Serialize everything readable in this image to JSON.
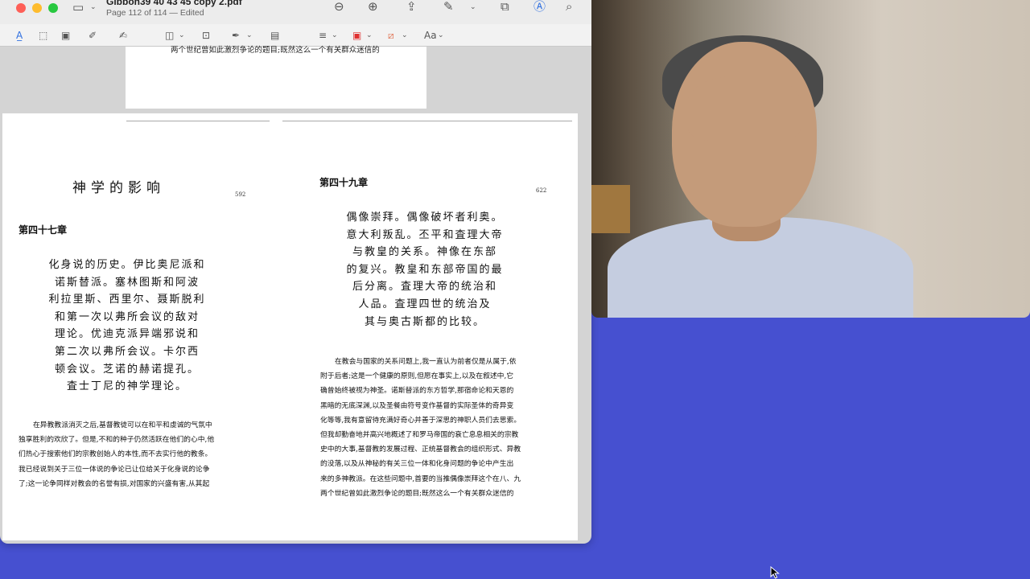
{
  "window": {
    "title": "Gibbon39 40 43 45 copy 2.pdf",
    "subtitle": "Page 112 of 114 — Edited"
  },
  "icons": [
    "sidebar-icon",
    "chevron-down-icon",
    "zoom-out-icon",
    "zoom-in-icon",
    "share-icon",
    "pencil-icon",
    "rotate-icon",
    "markup-icon",
    "search-icon",
    "text-selection-icon",
    "rect-selection-icon",
    "redact-icon",
    "sketch-icon",
    "draw-icon",
    "shapes-icon",
    "text-box-icon",
    "sign-icon",
    "note-icon",
    "line-style-icon",
    "border-color-icon",
    "fill-color-icon",
    "text-style-icon"
  ],
  "markup": {
    "text_style_label": "Aa"
  },
  "colors": {
    "desktop": "#4650d0",
    "border_color": "#e03030",
    "fill_color": "#e07050"
  },
  "prev_page": {
    "cut_line": "两个世纪曾如此激烈争论的题目;既然这么一个有关群众迷信的"
  },
  "left_page": {
    "heading": "神学的影响",
    "page_number": "592",
    "chapter": "第四十七章",
    "summary": [
      "化身说的历史。伊比奥尼派和",
      "诺斯替派。塞林图斯和阿波",
      "利拉里斯、西里尔、聂斯脱利",
      "和第一次以弗所会议的敌对",
      "理论。优迪克派异端邪说和",
      "第二次以弗所会议。卡尔西",
      "顿会议。芝诺的赫诺提孔。",
      "査士丁尼的神学理论。"
    ],
    "body": [
      "在异教教派消灭之后,基督教徒可以在和平和虔诚的气氛中",
      "独享胜利的欢欣了。但是,不和的种子仍然活跃在他们的心中,他",
      "们热心于搜索他们的宗教创始人的本性,而不去实行他的教条。",
      "我已经说到关于三位一体说的争论已让位给关于化身说的论争",
      "了;这一论争同样对教会的名誉有损,对国家的兴盛有害,从其起"
    ]
  },
  "right_page": {
    "chapter": "第四十九章",
    "page_number": "622",
    "summary": [
      "偶像崇拜。偶像破坏者利奥。",
      "意大利叛乱。丕平和査理大帝",
      "与教皇的关系。神像在东部",
      "的复兴。教皇和东部帝国的最",
      "后分离。査理大帝的统治和",
      "人品。査理四世的统治及",
      "其与奥古斯都的比较。"
    ],
    "body": [
      "在教会与国家的关系问题上,我一直认为前者仅是从属于,依",
      "附于后者;这是一个健康的原则,但愿在事实上,以及在叙述中,它",
      "确曾始终被视为神圣。诺斯替派的东方哲学,那宿命论和天恩的",
      "黑暗的无底深渊,以及圣餐由符号变作基督的实际圣体的奇异变",
      "化等等,我有意留待充满好奇心并善于深思的神职人员们去思索。",
      "但我却勤奋地并高兴地概述了和罗马帝国的衰亡息息相关的宗教",
      "史中的大事,基督教的发展过程、正统基督教会的组织形式、异教",
      "的没落,以及从神秘的有关三位一体和化身问题的争论中产生出",
      "来的多神教派。在这些问题中,首要的当推偶像崇拜这个在八、九",
      "两个世纪曾如此激烈争论的题目;既然这么一个有关群众迷信的"
    ]
  }
}
